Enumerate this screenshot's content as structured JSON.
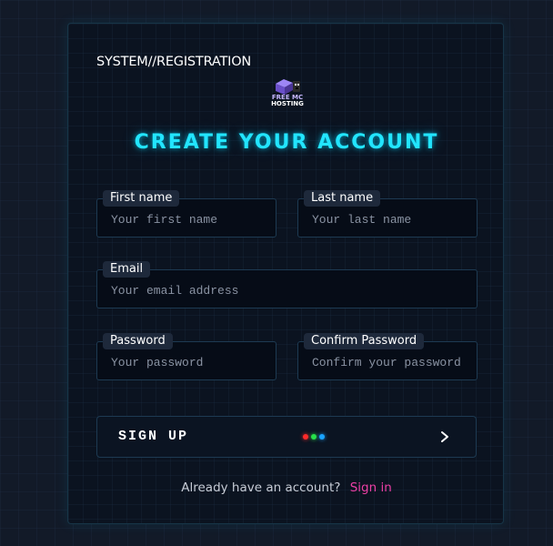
{
  "header": {
    "system_label": "SYSTEM//REGISTRATION",
    "logo": {
      "line1": "FREE MC",
      "line2": "HOSTING"
    },
    "title": "CREATE YOUR ACCOUNT"
  },
  "form": {
    "first_name": {
      "label": "First name",
      "placeholder": "Your first name",
      "value": ""
    },
    "last_name": {
      "label": "Last name",
      "placeholder": "Your last name",
      "value": ""
    },
    "email": {
      "label": "Email",
      "placeholder": "Your email address",
      "value": ""
    },
    "password": {
      "label": "Password",
      "placeholder": "Your password",
      "value": ""
    },
    "confirm_password": {
      "label": "Confirm Password",
      "placeholder": "Confirm your password",
      "value": ""
    }
  },
  "signup_button": {
    "label": "SIGN UP",
    "dot_colors": [
      "#ff2a2a",
      "#27e04a",
      "#1aa3ff"
    ],
    "icon": "chevron-right-icon"
  },
  "footer": {
    "question": "Already have an account?",
    "link": "Sign in"
  },
  "colors": {
    "accent_cyan": "#22e5ff",
    "link_pink": "#ec3fa5",
    "background": "#121a28"
  }
}
